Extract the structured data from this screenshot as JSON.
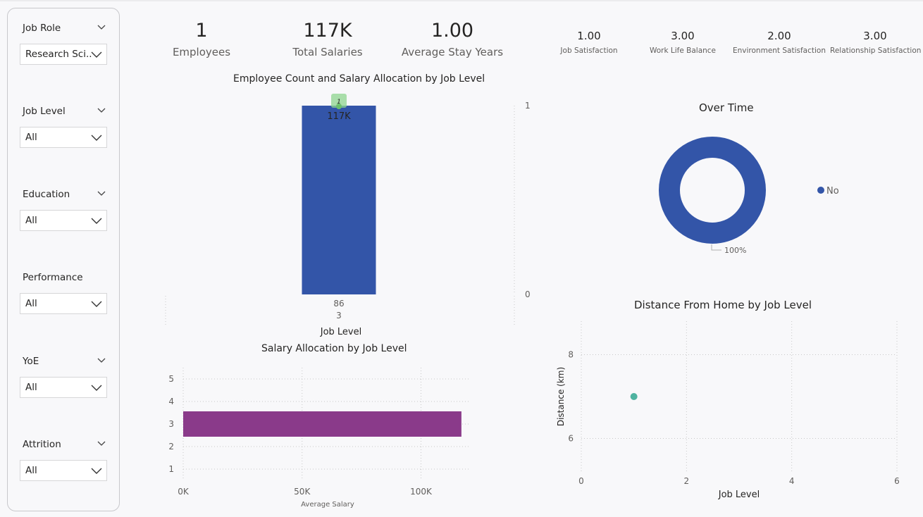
{
  "filters": [
    {
      "title": "Job Role",
      "value": "Research Sci..."
    },
    {
      "title": "Job Level",
      "value": "All"
    },
    {
      "title": "Education",
      "value": "All"
    },
    {
      "title": "Performance",
      "value": "All"
    },
    {
      "title": "YoE",
      "value": "All"
    },
    {
      "title": "Attrition",
      "value": "All"
    }
  ],
  "kpis": {
    "employees": {
      "value": "1",
      "label": "Employees"
    },
    "total_salaries": {
      "value": "117K",
      "label": "Total Salaries"
    },
    "average_stay": {
      "value": "1.00",
      "label": "Average Stay Years"
    },
    "job_satisfaction": {
      "value": "1.00",
      "label": "Job Satisfaction"
    },
    "work_life_balance": {
      "value": "3.00",
      "label": "Work Life Balance"
    },
    "environment_satisfaction": {
      "value": "2.00",
      "label": "Environment Satisfaction"
    },
    "relationship_satisfaction": {
      "value": "3.00",
      "label": "Relationship Satisfaction"
    }
  },
  "colors": {
    "bar_blue": "#3355a8",
    "bar_purple": "#8a3a8a",
    "marker_green": "#8fd68f",
    "scatter_teal": "#4fb3a0",
    "donut_blue": "#3355a8"
  },
  "chart_data": [
    {
      "id": "combo",
      "type": "bar",
      "title": "Employee Count and Salary Allocation by Job Level",
      "xlabel": "Job Level",
      "categories": [
        "3"
      ],
      "category_sub": [
        "86"
      ],
      "series": [
        {
          "values": [
            117000
          ],
          "data_labels": [
            "117K"
          ]
        },
        {
          "values": [
            1
          ],
          "data_labels": [
            "1"
          ]
        }
      ],
      "y2_ticks": [
        "0",
        "1"
      ],
      "y2lim": [
        0,
        1
      ]
    },
    {
      "id": "salary",
      "type": "bar",
      "orientation": "horizontal",
      "title": "Salary Allocation by Job Level",
      "xlabel": "Average Salary",
      "categories": [
        3
      ],
      "values": [
        117000
      ],
      "yticks": [
        "1",
        "2",
        "3",
        "4",
        "5"
      ],
      "ylim": [
        0.5,
        5.5
      ],
      "xticks": [
        "0K",
        "50K",
        "100K"
      ],
      "xlim": [
        0,
        120000
      ]
    },
    {
      "id": "overtime",
      "type": "pie",
      "title": "Over Time",
      "slices": [
        {
          "label": "No",
          "value": 100,
          "pct_label": "100%"
        }
      ],
      "legend": "right"
    },
    {
      "id": "distance",
      "type": "scatter",
      "title": "Distance From Home by Job Level",
      "xlabel": "Job Level",
      "ylabel": "Distance (km)",
      "points": [
        {
          "x": 1,
          "y": 7
        }
      ],
      "xticks": [
        "0",
        "2",
        "4",
        "6"
      ],
      "xlim": [
        0,
        6
      ],
      "yticks": [
        "6",
        "8"
      ],
      "ylim": [
        5.2,
        8.8
      ]
    }
  ]
}
